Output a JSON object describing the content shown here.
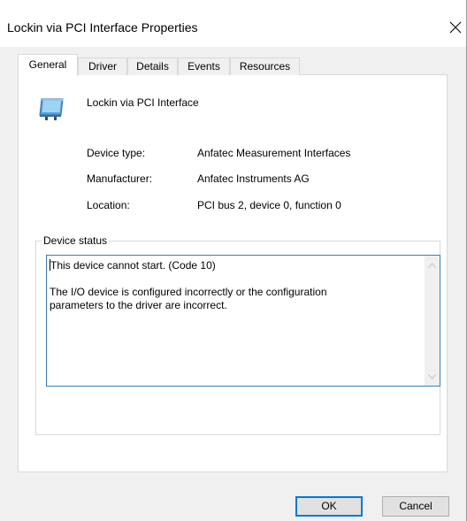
{
  "window": {
    "title": "Lockin via PCI Interface Properties"
  },
  "tabs": [
    {
      "label": "General",
      "active": true
    },
    {
      "label": "Driver",
      "active": false
    },
    {
      "label": "Details",
      "active": false
    },
    {
      "label": "Events",
      "active": false
    },
    {
      "label": "Resources",
      "active": false
    }
  ],
  "device": {
    "name": "Lockin via PCI Interface",
    "icon": "network-adapter-icon"
  },
  "properties": [
    {
      "label": "Device type:",
      "value": "Anfatec Measurement Interfaces"
    },
    {
      "label": "Manufacturer:",
      "value": "Anfatec Instruments AG"
    },
    {
      "label": "Location:",
      "value": "PCI bus 2, device 0, function 0"
    }
  ],
  "status": {
    "group_label": "Device status",
    "lines": [
      "This device cannot start. (Code 10)",
      "",
      "The I/O device is configured incorrectly or the configuration",
      "parameters to the driver are incorrect."
    ]
  },
  "buttons": {
    "ok_label": "OK",
    "cancel_label": "Cancel"
  },
  "colors": {
    "accent": "#0078d7",
    "focus_border": "#3c7fb1",
    "dialog_bg": "#f0f0f0"
  }
}
